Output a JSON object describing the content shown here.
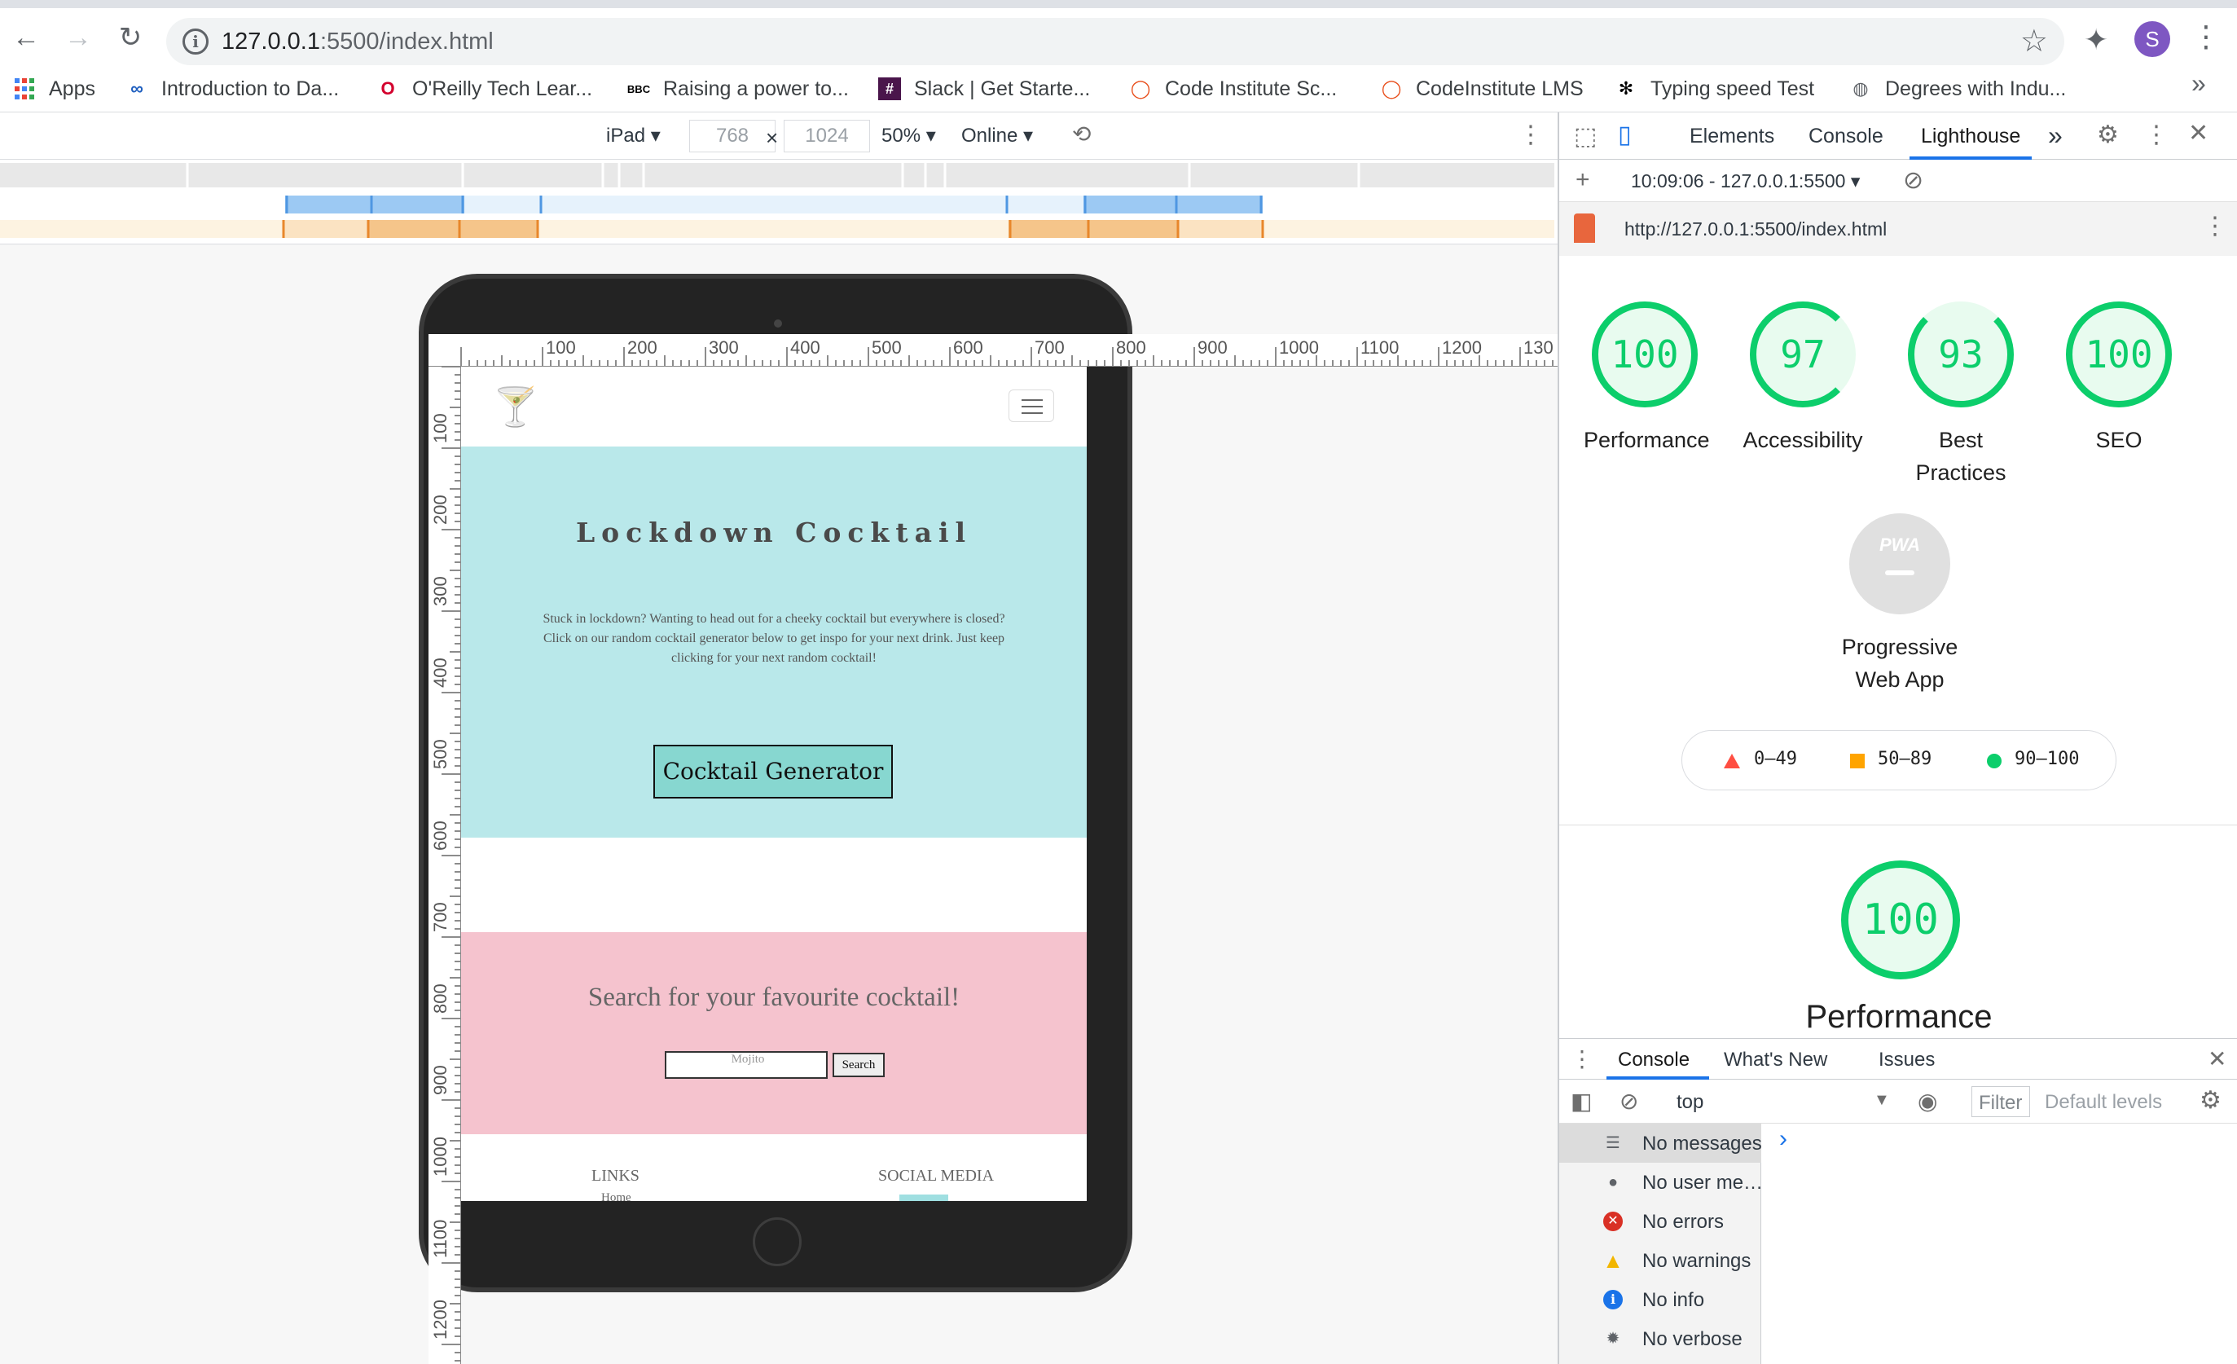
{
  "browser": {
    "url_host": "127.0.0.1",
    "url_rest": ":5500/index.html",
    "profile_initial": "S",
    "bookmarks": [
      {
        "label": "Apps",
        "icon": "apps-grid-icon"
      },
      {
        "label": "Introduction to Da...",
        "icon": "infinity-icon"
      },
      {
        "label": "O'Reilly Tech Lear...",
        "icon": "oreilly-icon"
      },
      {
        "label": "Raising a power to...",
        "icon": "bbc-icon"
      },
      {
        "label": "Slack | Get Starte...",
        "icon": "slack-icon"
      },
      {
        "label": "Code Institute Sc...",
        "icon": "code-institute-icon"
      },
      {
        "label": "CodeInstitute LMS",
        "icon": "code-institute-icon"
      },
      {
        "label": "Typing speed Test",
        "icon": "paw-icon"
      },
      {
        "label": "Degrees with Indu...",
        "icon": "globe-icon"
      }
    ],
    "more_bookmarks": "»"
  },
  "device_toolbar": {
    "device": "iPad",
    "width": "768",
    "times": "×",
    "height": "1024",
    "zoom": "50%",
    "throttle": "Online"
  },
  "ruler": {
    "top_ticks": [
      "100",
      "200",
      "300",
      "400",
      "500",
      "600",
      "700",
      "800",
      "900",
      "1000",
      "1100",
      "1200",
      "130"
    ],
    "left_ticks": [
      "100",
      "200",
      "300",
      "400",
      "500",
      "600",
      "700",
      "800",
      "900",
      "1000",
      "1100",
      "1200"
    ]
  },
  "site": {
    "logo_glyph": "🍸",
    "hero_title": "Lockdown Cocktail",
    "hero_text": "Stuck in lockdown? Wanting to head out for a cheeky cocktail but everywhere is closed? Click on our random cocktail generator below to get inspo for your next drink. Just keep clicking for your next random cocktail!",
    "generator_button": "Cocktail Generator",
    "search_heading": "Search for your favourite cocktail!",
    "search_placeholder": "Mojito",
    "search_button": "Search",
    "footer_links": "LINKS",
    "footer_home": "Home",
    "footer_social": "SOCIAL MEDIA"
  },
  "devtools": {
    "tabs": [
      "Elements",
      "Console",
      "Lighthouse"
    ],
    "active_tab": "Lighthouse",
    "more_tabs": "»",
    "report_label": "10:09:06 - 127.0.0.1:5500",
    "report_url": "http://127.0.0.1:5500/index.html",
    "scores": [
      {
        "value": "100",
        "label": "Performance"
      },
      {
        "value": "97",
        "label": "Accessibility"
      },
      {
        "value": "93",
        "label": "Best Practices"
      },
      {
        "value": "100",
        "label": "SEO"
      }
    ],
    "pwa_badge": "PWA",
    "pwa_label": "Progressive Web App",
    "legend": [
      {
        "range": "0–49",
        "color": "#ff4e42"
      },
      {
        "range": "50–89",
        "color": "#ffa400"
      },
      {
        "range": "90–100",
        "color": "#0cce6b"
      }
    ],
    "perf_score": "100",
    "perf_title": "Performance",
    "score_color": "#0cce6b",
    "drawer_tabs": [
      "Console",
      "What's New",
      "Issues"
    ],
    "context": "top",
    "filter_placeholder": "Filter",
    "levels": "Default levels",
    "sidebar": [
      {
        "label": "No messages",
        "icon": "list-icon"
      },
      {
        "label": "No user me…",
        "icon": "user-icon"
      },
      {
        "label": "No errors",
        "icon": "error-icon"
      },
      {
        "label": "No warnings",
        "icon": "warning-icon"
      },
      {
        "label": "No info",
        "icon": "info-icon"
      },
      {
        "label": "No verbose",
        "icon": "bug-icon"
      }
    ],
    "prompt": "›"
  }
}
